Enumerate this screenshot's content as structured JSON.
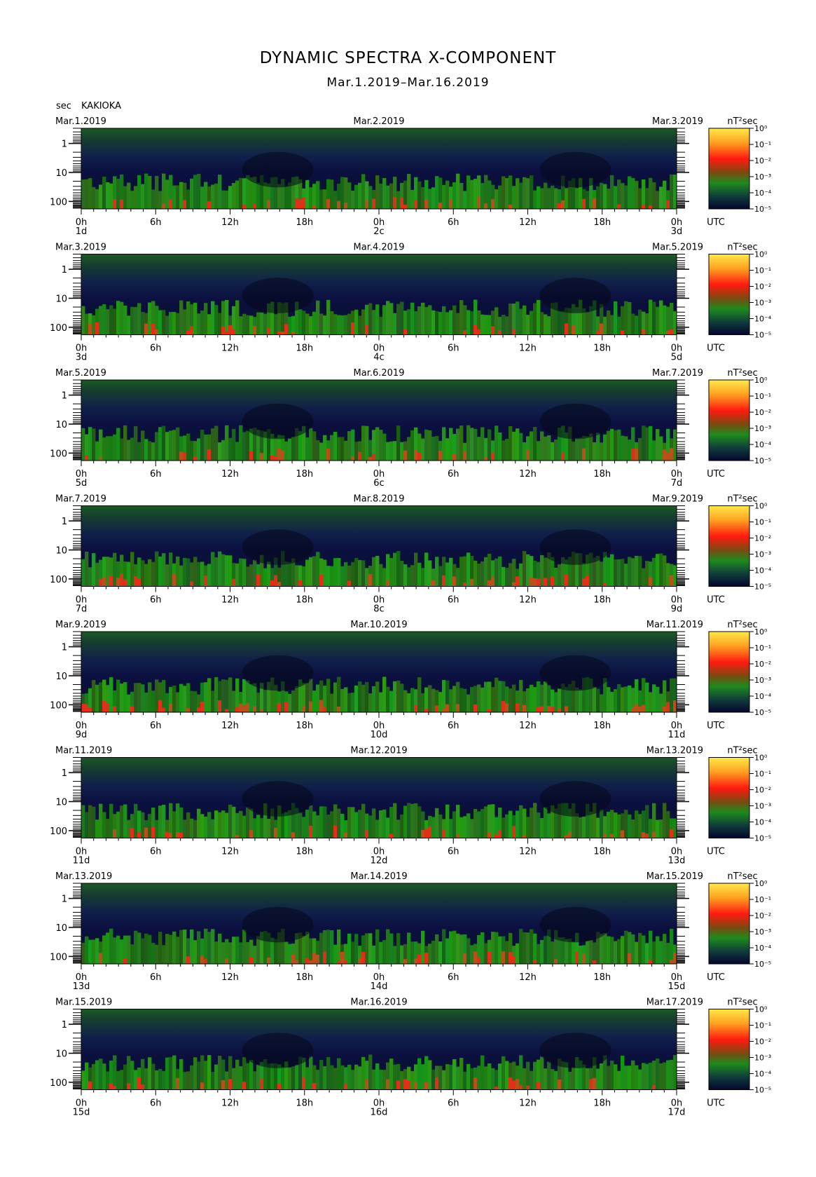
{
  "title": "DYNAMIC SPECTRA X-COMPONENT",
  "subtitle": "Mar.1.2019–Mar.16.2019",
  "y_unit_label": "sec",
  "station": "KAKIOKA",
  "colorbar_unit": "nT²sec",
  "colorbar_labels": [
    "10⁰",
    "10⁻¹",
    "10⁻²",
    "10⁻³",
    "10⁻⁴",
    "10⁻⁵"
  ],
  "colors": {
    "background_low": "#0a0a3c",
    "mid": "#1f7a1f",
    "high": "#ff2a10",
    "peak": "#ffff00"
  },
  "chart_data": {
    "type": "heatmap",
    "y_axis": {
      "label": "sec",
      "scale": "log",
      "tick_labels": [
        "1",
        "10",
        "100"
      ],
      "range": [
        0.3,
        180
      ]
    },
    "x_axis": {
      "tick_labels": [
        "0h",
        "6h",
        "12h",
        "18h",
        "0h",
        "6h",
        "12h",
        "18h",
        "0h"
      ],
      "utc_label": "UTC"
    },
    "colorbar": {
      "unit": "nT²sec",
      "scale": "log",
      "range": [
        1e-05,
        1
      ]
    },
    "panels": [
      {
        "date_left": "Mar.1.2019",
        "date_mid": "Mar.2.2019",
        "date_right": "Mar.3.2019",
        "day_left": "1d",
        "day_mid": "2c",
        "day_right": "3d"
      },
      {
        "date_left": "Mar.3.2019",
        "date_mid": "Mar.4.2019",
        "date_right": "Mar.5.2019",
        "day_left": "3d",
        "day_mid": "4c",
        "day_right": "5d"
      },
      {
        "date_left": "Mar.5.2019",
        "date_mid": "Mar.6.2019",
        "date_right": "Mar.7.2019",
        "day_left": "5d",
        "day_mid": "6c",
        "day_right": "7d"
      },
      {
        "date_left": "Mar.7.2019",
        "date_mid": "Mar.8.2019",
        "date_right": "Mar.9.2019",
        "day_left": "7d",
        "day_mid": "8c",
        "day_right": "9d"
      },
      {
        "date_left": "Mar.9.2019",
        "date_mid": "Mar.10.2019",
        "date_right": "Mar.11.2019",
        "day_left": "9d",
        "day_mid": "10d",
        "day_right": "11d"
      },
      {
        "date_left": "Mar.11.2019",
        "date_mid": "Mar.12.2019",
        "date_right": "Mar.13.2019",
        "day_left": "11d",
        "day_mid": "12d",
        "day_right": "13d"
      },
      {
        "date_left": "Mar.13.2019",
        "date_mid": "Mar.14.2019",
        "date_right": "Mar.15.2019",
        "day_left": "13d",
        "day_mid": "14d",
        "day_right": "15d"
      },
      {
        "date_left": "Mar.15.2019",
        "date_mid": "Mar.16.2019",
        "date_right": "Mar.17.2019",
        "day_left": "15d",
        "day_mid": "16d",
        "day_right": "17d"
      }
    ]
  }
}
